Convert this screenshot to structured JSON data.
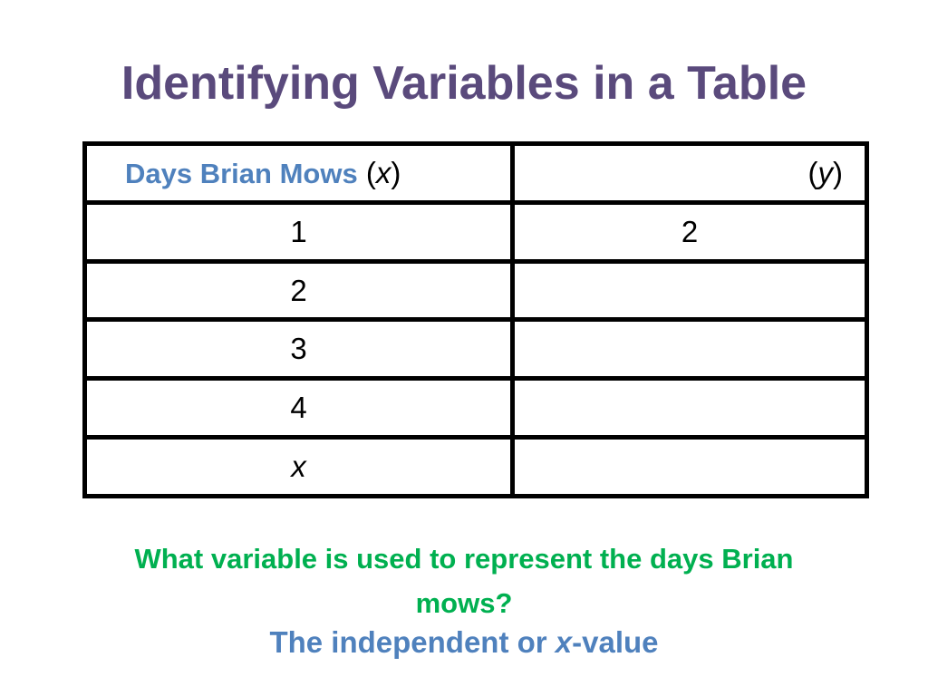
{
  "slide": {
    "title": "Identifying Variables in a Table",
    "colors": {
      "title": "#5a4a7c",
      "header_label": "#4f81bd",
      "question": "#00b050",
      "answer": "#4f81bd",
      "table_border": "#000000"
    }
  },
  "table": {
    "headers": [
      {
        "label": "Days Brian Mows",
        "paren_open": " (",
        "variable": "x",
        "paren_close": ")"
      },
      {
        "label": "",
        "paren_open": "(",
        "variable": "y",
        "paren_close": ")"
      }
    ],
    "rows": [
      {
        "x": "1",
        "y": "2"
      },
      {
        "x": "2",
        "y": ""
      },
      {
        "x": "3",
        "y": ""
      },
      {
        "x": "4",
        "y": ""
      },
      {
        "x": "x",
        "y": ""
      }
    ]
  },
  "question": {
    "line1": "What variable is used to represent the days Brian",
    "line2": "mows?"
  },
  "answer": {
    "prefix": "The independent or ",
    "variable": "x",
    "suffix": "-value"
  }
}
